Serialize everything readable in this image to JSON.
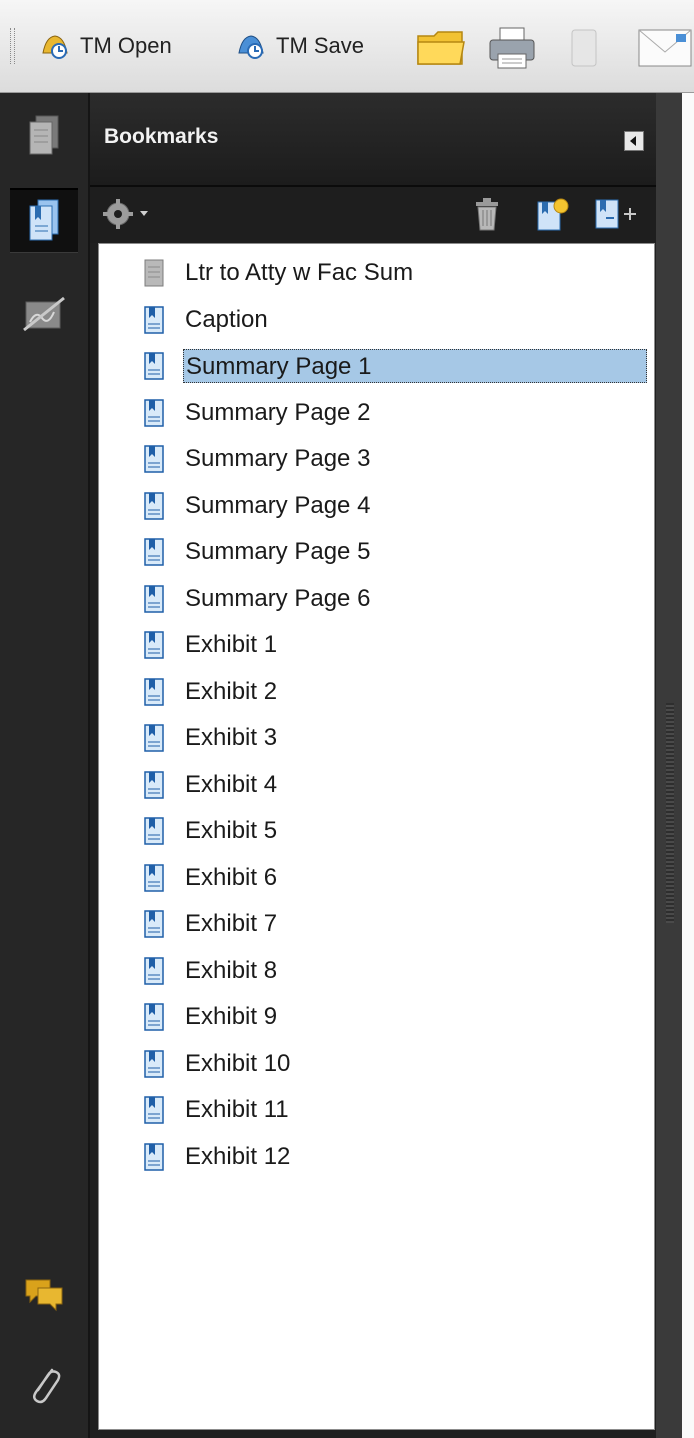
{
  "toolbar": {
    "tm_open_label": "TM Open",
    "tm_save_label": "TM Save"
  },
  "panel": {
    "title": "Bookmarks"
  },
  "bookmarks": [
    {
      "label": "Ltr to Atty w Fac Sum",
      "icon": "page-gray-icon"
    },
    {
      "label": "Caption",
      "icon": "bookmark-icon"
    },
    {
      "label": "Summary Page 1",
      "icon": "bookmark-icon",
      "selected": true
    },
    {
      "label": "Summary Page 2",
      "icon": "bookmark-icon"
    },
    {
      "label": "Summary Page 3",
      "icon": "bookmark-icon"
    },
    {
      "label": "Summary Page 4",
      "icon": "bookmark-icon"
    },
    {
      "label": "Summary Page 5",
      "icon": "bookmark-icon"
    },
    {
      "label": "Summary Page 6",
      "icon": "bookmark-icon"
    },
    {
      "label": "Exhibit 1",
      "icon": "bookmark-icon"
    },
    {
      "label": "Exhibit 2",
      "icon": "bookmark-icon"
    },
    {
      "label": "Exhibit 3",
      "icon": "bookmark-icon"
    },
    {
      "label": "Exhibit 4",
      "icon": "bookmark-icon"
    },
    {
      "label": "Exhibit 5",
      "icon": "bookmark-icon"
    },
    {
      "label": "Exhibit 6",
      "icon": "bookmark-icon"
    },
    {
      "label": "Exhibit 7",
      "icon": "bookmark-icon"
    },
    {
      "label": "Exhibit 8",
      "icon": "bookmark-icon"
    },
    {
      "label": "Exhibit 9",
      "icon": "bookmark-icon"
    },
    {
      "label": "Exhibit 10",
      "icon": "bookmark-icon"
    },
    {
      "label": "Exhibit 11",
      "icon": "bookmark-icon"
    },
    {
      "label": "Exhibit 12",
      "icon": "bookmark-icon"
    }
  ],
  "colors": {
    "selection": "#a6c8e6",
    "panel_dark": "#202020",
    "list_bg": "#ffffff"
  }
}
